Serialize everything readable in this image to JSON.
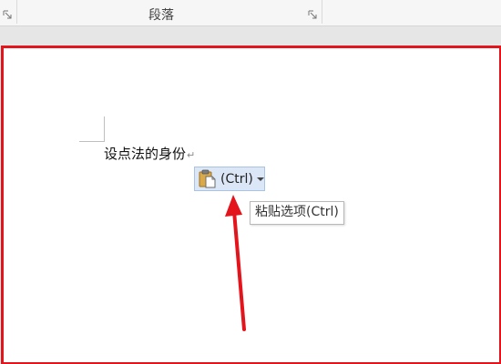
{
  "ribbon": {
    "group_label": "段落"
  },
  "document": {
    "text": "设点法的身份",
    "paragraph_mark": "↵"
  },
  "paste_options": {
    "label": "(Ctrl)",
    "icon": "clipboard-paste-icon"
  },
  "tooltip": {
    "text": "粘贴选项(Ctrl)"
  },
  "colors": {
    "annotation_red": "#e3141b",
    "paste_button_bg": "#dbe7f7",
    "paste_button_border": "#a9c3e6"
  }
}
